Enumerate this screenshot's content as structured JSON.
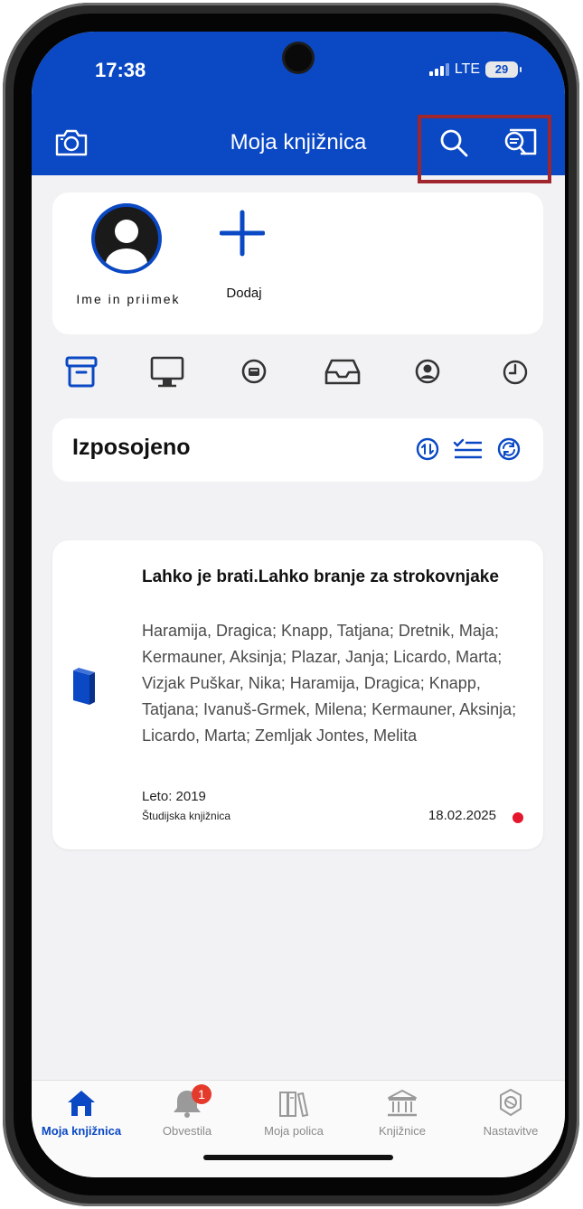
{
  "status_bar": {
    "time": "17:38",
    "network": "LTE",
    "battery": "29"
  },
  "header": {
    "title": "Moja knjižnica",
    "background": "#0a48c4",
    "highlight_color": "#a0262d",
    "icons": {
      "left": "camera-icon",
      "right": [
        "search-icon",
        "catalog-search-icon"
      ]
    }
  },
  "profile": {
    "name": "Ime in priimek",
    "add_label": "Dodaj"
  },
  "tabs": [
    "archive-icon",
    "desktop-icon",
    "reservation-icon",
    "inbox-icon",
    "user-circle-icon",
    "history-icon"
  ],
  "section": {
    "title": "Izposojeno",
    "actions": [
      "sort-icon",
      "checklist-icon",
      "refresh-icon"
    ]
  },
  "loans": [
    {
      "title": "Lahko je brati.Lahko branje za strokovnjake",
      "authors": "Haramija, Dragica; Knapp, Tatjana; Dretnik, Maja; Kermauner, Aksinja; Plazar, Janja; Licardo, Marta; Vizjak Puškar, Nika; Haramija, Dragica; Knapp, Tatjana; Ivanuš-Grmek, Milena; Kermauner, Aksinja; Licardo, Marta; Zemljak Jontes, Melita",
      "year": "Leto: 2019",
      "library": "Študijska knjižnica",
      "due_date": "18.02.2025",
      "status_color": "#e4172c"
    }
  ],
  "bottom_nav": {
    "items": [
      {
        "label": "Moja knjižnica",
        "icon": "home-icon",
        "active": true
      },
      {
        "label": "Obvestila",
        "icon": "bell-icon",
        "badge": "1"
      },
      {
        "label": "Moja polica",
        "icon": "bookshelf-icon"
      },
      {
        "label": "Knjižnice",
        "icon": "library-building-icon"
      },
      {
        "label": "Nastavitve",
        "icon": "settings-icon"
      }
    ]
  }
}
